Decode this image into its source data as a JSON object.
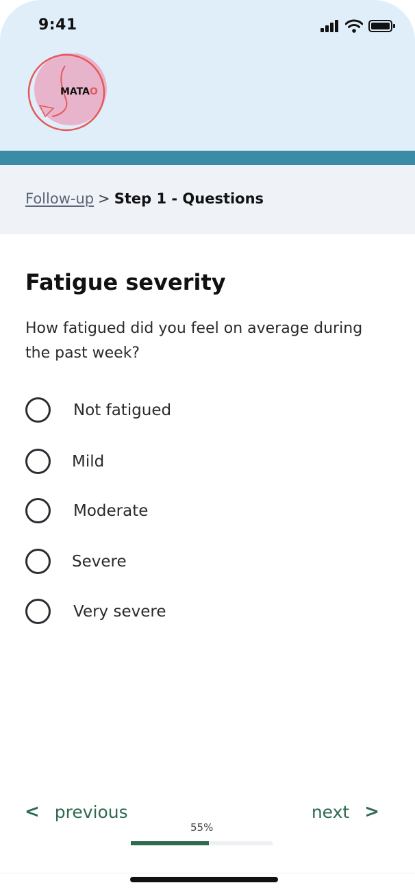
{
  "status_bar": {
    "time": "9:41",
    "icons": [
      "signal-icon",
      "wifi-icon",
      "battery-icon"
    ]
  },
  "logo": {
    "text_main": "MATA",
    "text_accent": "O",
    "accent_color": "#e35a5a",
    "circle_color": "#e8b4cc"
  },
  "breadcrumb": {
    "link": "Follow-up",
    "separator": ">",
    "current": "Step 1 - Questions"
  },
  "question": {
    "title": "Fatigue severity",
    "text": "How fatigued did you feel on average during the past week?",
    "options": [
      "Not fatigued",
      "Mild",
      "Moderate",
      "Severe",
      "Very severe"
    ],
    "selected": null
  },
  "navigation": {
    "previous_label": "previous",
    "next_label": "next"
  },
  "progress": {
    "label": "55%",
    "value": 0.55
  },
  "colors": {
    "header_bg": "#dfeef9",
    "teal_bar": "#3b8ba6",
    "breadcrumb_bg": "#eff3f8",
    "accent_green": "#2e6a4f"
  }
}
